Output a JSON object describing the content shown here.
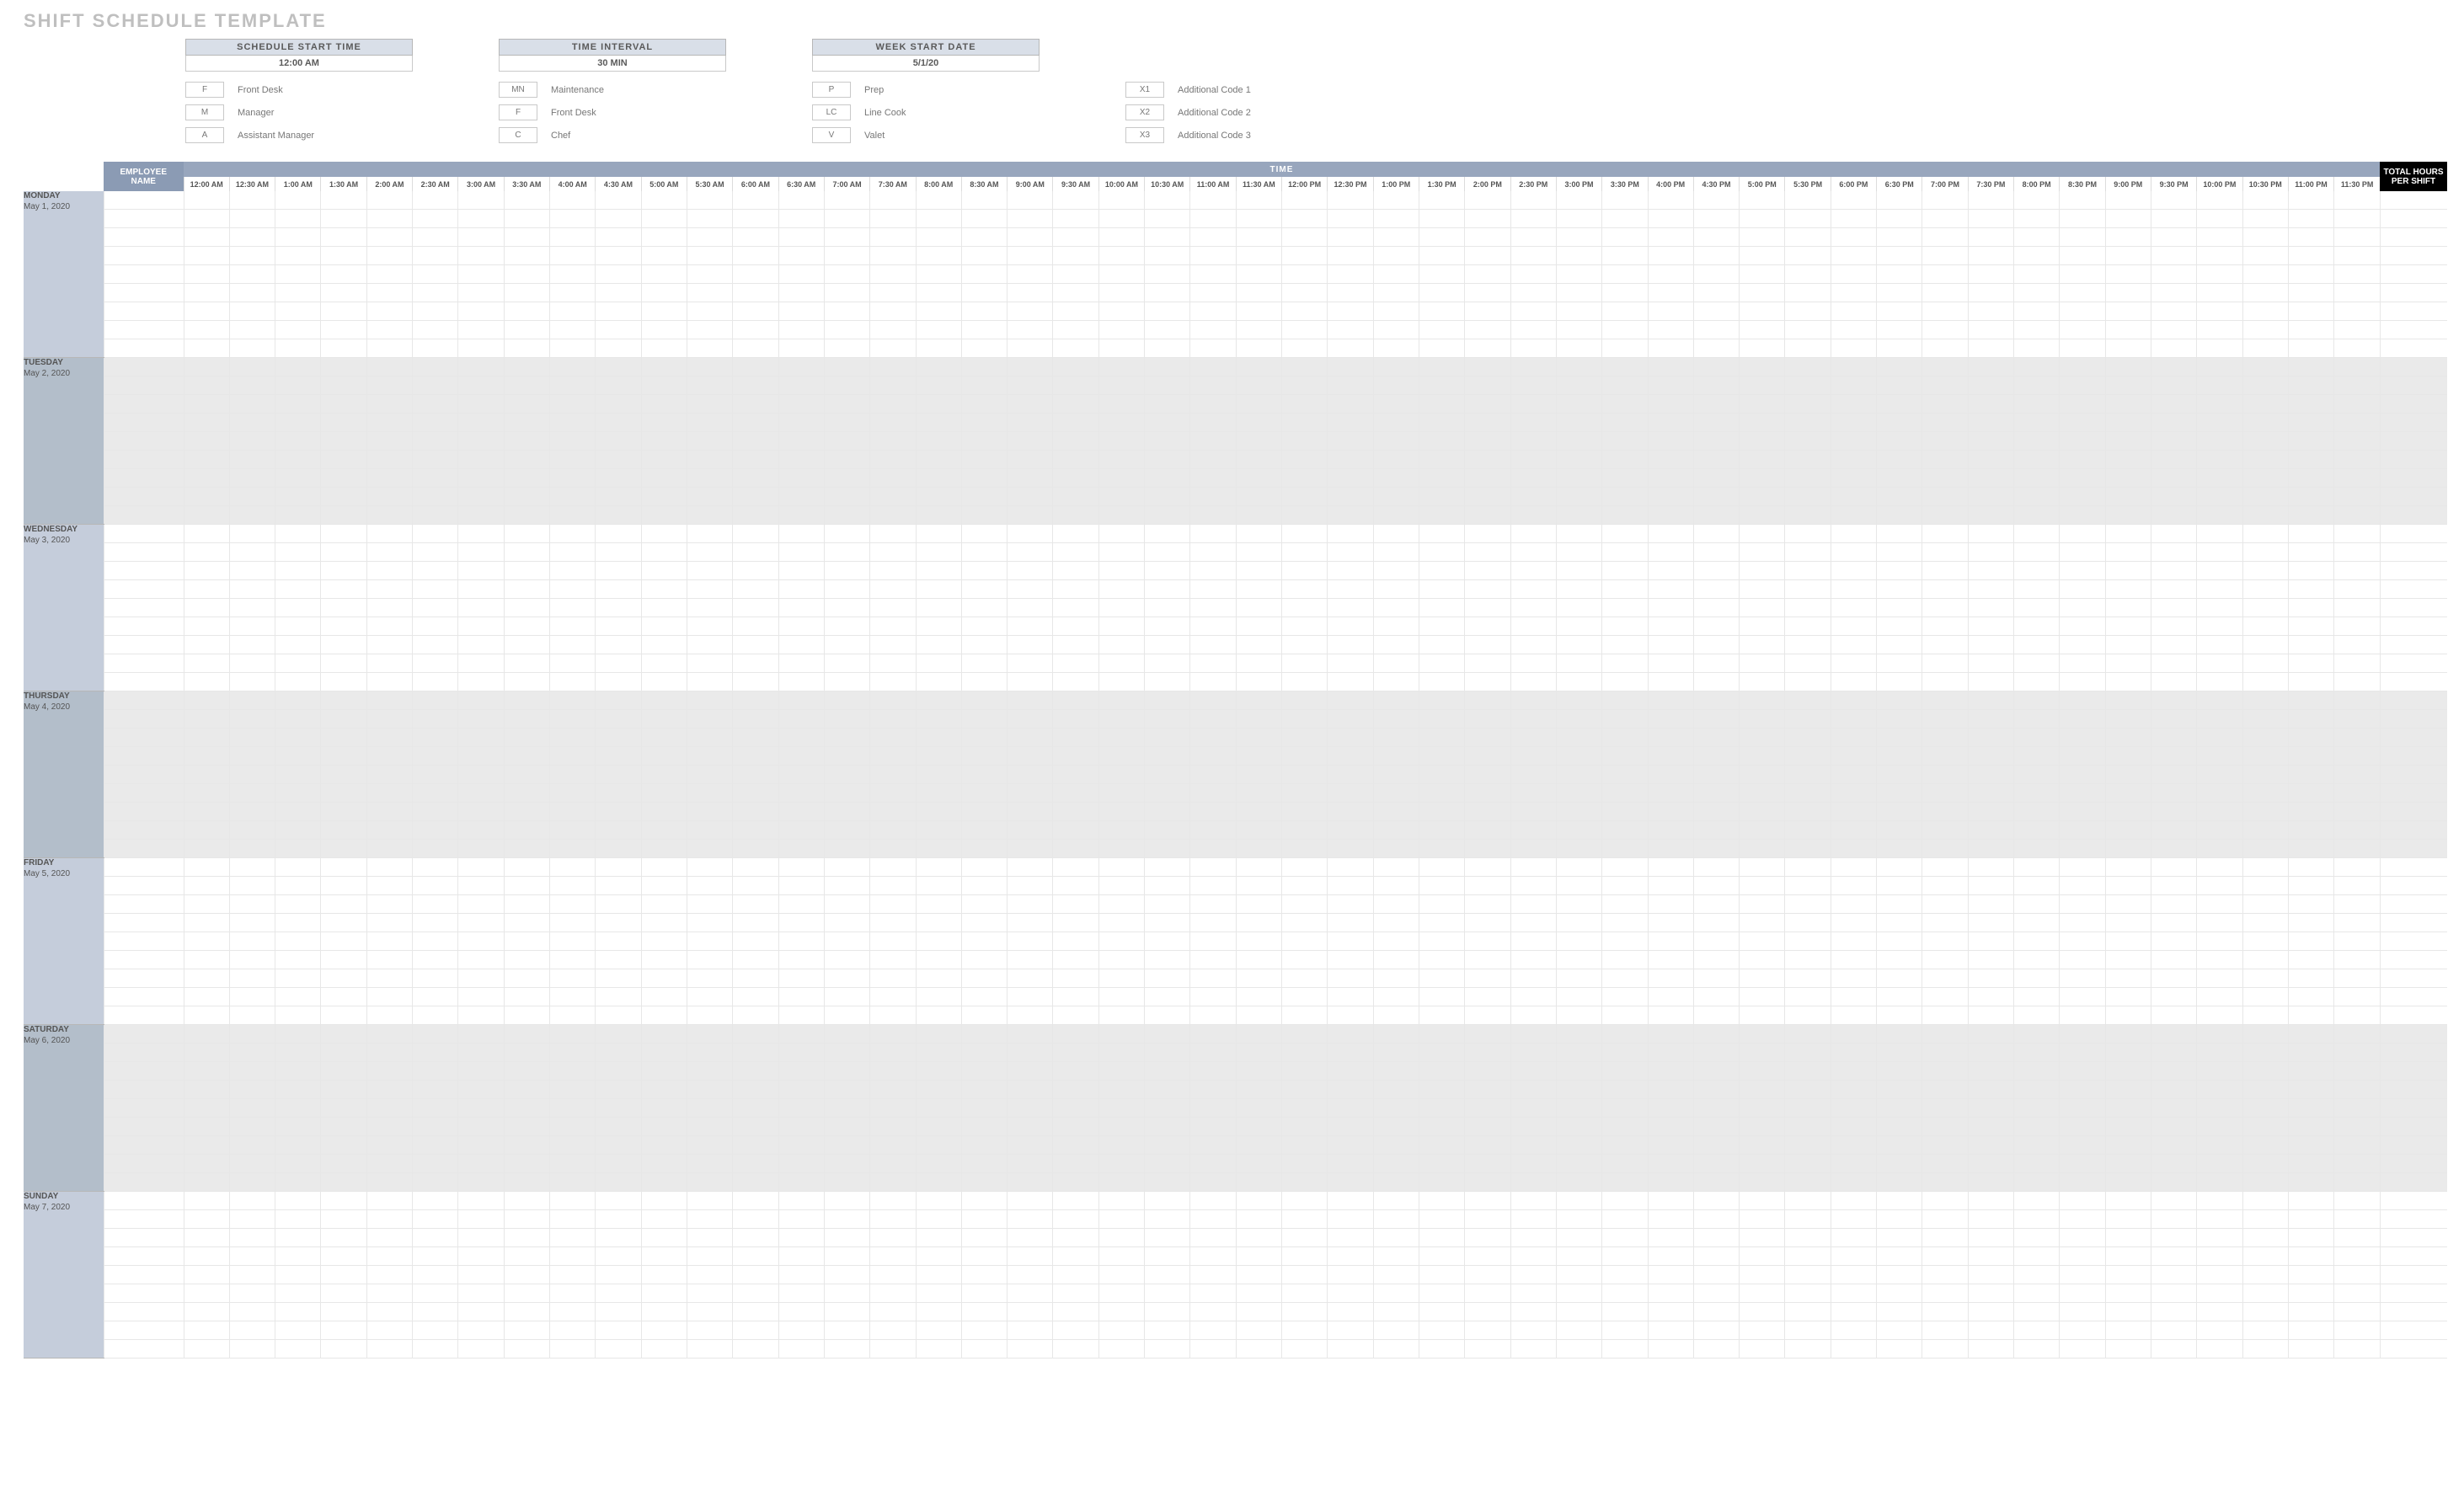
{
  "title": "SHIFT SCHEDULE TEMPLATE",
  "params": {
    "start_time": {
      "label": "SCHEDULE START TIME",
      "value": "12:00 AM"
    },
    "interval": {
      "label": "TIME INTERVAL",
      "value": "30 MIN"
    },
    "week_start": {
      "label": "WEEK START DATE",
      "value": "5/1/20"
    }
  },
  "codes": [
    [
      {
        "code": "F",
        "label": "Front Desk"
      },
      {
        "code": "M",
        "label": "Manager"
      },
      {
        "code": "A",
        "label": "Assistant Manager"
      }
    ],
    [
      {
        "code": "MN",
        "label": "Maintenance"
      },
      {
        "code": "F",
        "label": "Front Desk"
      },
      {
        "code": "C",
        "label": "Chef"
      }
    ],
    [
      {
        "code": "P",
        "label": "Prep"
      },
      {
        "code": "LC",
        "label": "Line Cook"
      },
      {
        "code": "V",
        "label": "Valet"
      }
    ],
    [
      {
        "code": "X1",
        "label": "Additional Code 1"
      },
      {
        "code": "X2",
        "label": "Additional Code 2"
      },
      {
        "code": "X3",
        "label": "Additional Code 3"
      }
    ]
  ],
  "headers": {
    "time": "TIME",
    "employee": "EMPLOYEE NAME",
    "total": "TOTAL HOURS PER SHIFT"
  },
  "time_slots": [
    "12:00 AM",
    "12:30 AM",
    "1:00 AM",
    "1:30 AM",
    "2:00 AM",
    "2:30 AM",
    "3:00 AM",
    "3:30 AM",
    "4:00 AM",
    "4:30 AM",
    "5:00 AM",
    "5:30 AM",
    "6:00 AM",
    "6:30 AM",
    "7:00 AM",
    "7:30 AM",
    "8:00 AM",
    "8:30 AM",
    "9:00 AM",
    "9:30 AM",
    "10:00 AM",
    "10:30 AM",
    "11:00 AM",
    "11:30 AM",
    "12:00 PM",
    "12:30 PM",
    "1:00 PM",
    "1:30 PM",
    "2:00 PM",
    "2:30 PM",
    "3:00 PM",
    "3:30 PM",
    "4:00 PM",
    "4:30 PM",
    "5:00 PM",
    "5:30 PM",
    "6:00 PM",
    "6:30 PM",
    "7:00 PM",
    "7:30 PM",
    "8:00 PM",
    "8:30 PM",
    "9:00 PM",
    "9:30 PM",
    "10:00 PM",
    "10:30 PM",
    "11:00 PM",
    "11:30 PM"
  ],
  "days": [
    {
      "name": "MONDAY",
      "date": "May 1, 2020",
      "alt": false
    },
    {
      "name": "TUESDAY",
      "date": "May 2, 2020",
      "alt": true
    },
    {
      "name": "WEDNESDAY",
      "date": "May 3, 2020",
      "alt": false
    },
    {
      "name": "THURSDAY",
      "date": "May 4, 2020",
      "alt": true
    },
    {
      "name": "FRIDAY",
      "date": "May 5, 2020",
      "alt": false
    },
    {
      "name": "SATURDAY",
      "date": "May 6, 2020",
      "alt": true
    },
    {
      "name": "SUNDAY",
      "date": "May 7, 2020",
      "alt": false
    }
  ],
  "rows_per_day": 9
}
